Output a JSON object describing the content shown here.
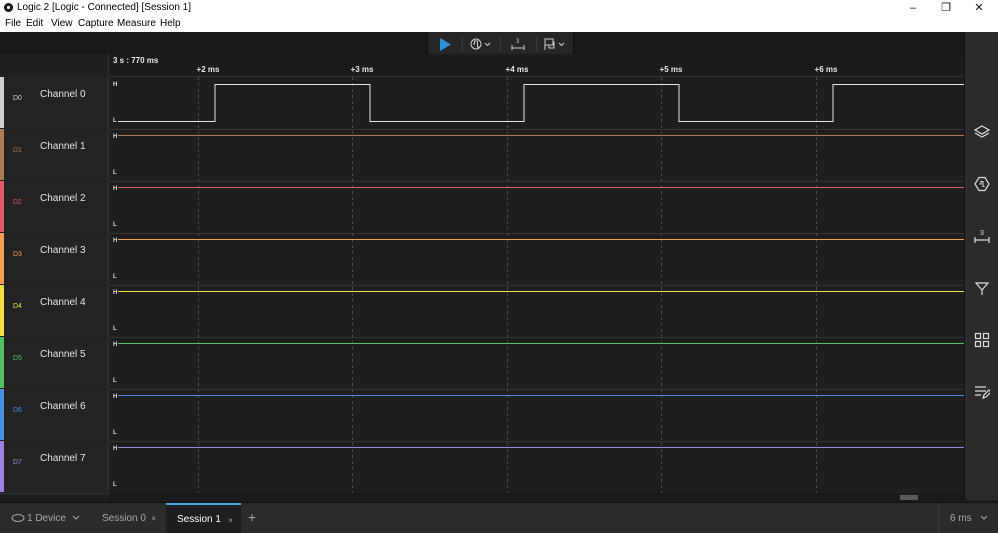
{
  "window": {
    "title": "Logic 2 [Logic - Connected] [Session 1]"
  },
  "menu": [
    "File",
    "Edit",
    "View",
    "Capture",
    "Measure",
    "Help"
  ],
  "timeline": {
    "origin_label": "3 s : 770 ms",
    "ticks": [
      "+2 ms",
      "+3 ms",
      "+4 ms",
      "+5 ms",
      "+6 ms"
    ]
  },
  "channels": [
    {
      "id": "D0",
      "name": "Channel 0",
      "color": "#d0d0d0",
      "h": "H",
      "l": "L"
    },
    {
      "id": "D1",
      "name": "Channel 1",
      "color": "#b07a55",
      "h": "H",
      "l": "L"
    },
    {
      "id": "D2",
      "name": "Channel 2",
      "color": "#e05a68",
      "h": "H",
      "l": "L"
    },
    {
      "id": "D3",
      "name": "Channel 3",
      "color": "#f0a050",
      "h": "H",
      "l": "L"
    },
    {
      "id": "D4",
      "name": "Channel 4",
      "color": "#f0e040",
      "h": "H",
      "l": "L"
    },
    {
      "id": "D5",
      "name": "Channel 5",
      "color": "#50c060",
      "h": "H",
      "l": "L"
    },
    {
      "id": "D6",
      "name": "Channel 6",
      "color": "#4a90e2",
      "h": "H",
      "l": "L"
    },
    {
      "id": "D7",
      "name": "Channel 7",
      "color": "#a080e0",
      "h": "H",
      "l": "L"
    }
  ],
  "toolbar": {
    "play_icon": "play-icon",
    "trigger_icon": "trigger-icon",
    "measure_icon": "measure-icon",
    "marker_icon": "marker-icon",
    "accent": "#2d8fd6"
  },
  "bottom": {
    "device_label": "1 Device",
    "sessions": [
      {
        "label": "Session 0",
        "close": "×"
      },
      {
        "label": "Session 1",
        "close": "×"
      }
    ],
    "add": "+",
    "zoom": "6 ms"
  }
}
